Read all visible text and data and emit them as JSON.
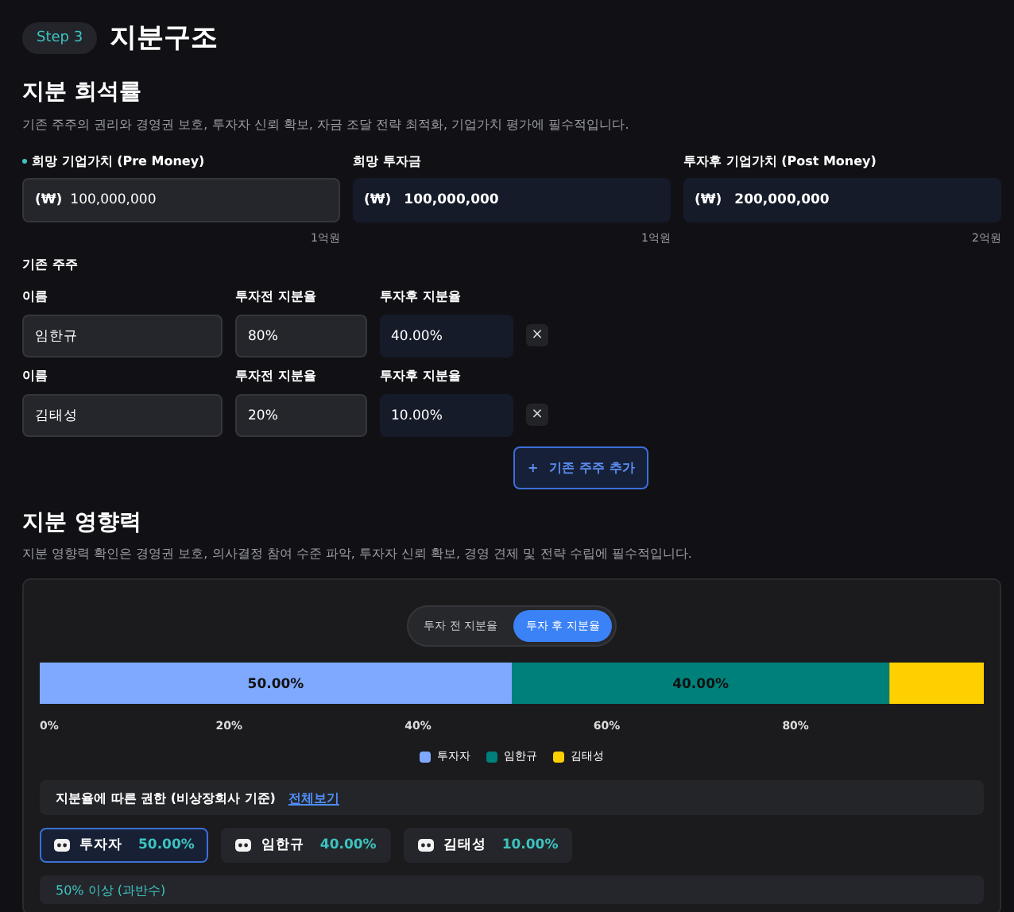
{
  "step": {
    "badge": "Step 3",
    "title": "지분구조"
  },
  "dilution": {
    "title": "지분 희석률",
    "description": "기존 주주의 권리와 경영권 보호, 투자자 신뢰 확보, 자금 조달 전략 최적화, 기업가치 평가에 필수적입니다.",
    "fields": [
      {
        "label": "희망 기업가치 (Pre Money)",
        "required": true,
        "kind": "input",
        "prefix": "(₩)",
        "value": "100,000,000",
        "hint": "1억원"
      },
      {
        "label": "희망 투자금",
        "required": false,
        "kind": "computed",
        "prefix": "(₩)",
        "value": "100,000,000",
        "hint": "1억원"
      },
      {
        "label": "투자후 기업가치 (Post Money)",
        "required": false,
        "kind": "computed",
        "prefix": "(₩)",
        "value": "200,000,000",
        "hint": "2억원"
      }
    ]
  },
  "shareholders": {
    "title": "기존 주주",
    "rows": [
      {
        "name_label": "이름",
        "name": "임한규",
        "pre_label": "투자전 지분율",
        "pre": "80%",
        "post_label": "투자후 지분율",
        "post": "40.00%",
        "remove": "×"
      },
      {
        "name_label": "이름",
        "name": "김태성",
        "pre_label": "투자전 지분율",
        "pre": "20%",
        "post_label": "투자후 지분율",
        "post": "10.00%",
        "remove": "×"
      }
    ],
    "add_button": {
      "icon": "+",
      "label": "기존 주주 추가"
    }
  },
  "influence": {
    "title": "지분 영향력",
    "description": "지분 영향력 확인은 경영권 보호, 의사결정 참여 수준 파악, 투자자 신뢰 확보, 경영 견제 및 전략 수립에 필수적입니다.",
    "toggle": [
      {
        "label": "투자 전 지분율",
        "selected": false
      },
      {
        "label": "투자 후 지분율",
        "selected": true
      }
    ],
    "chart_data": {
      "type": "bar",
      "orientation": "horizontal",
      "stacked": true,
      "series": [
        {
          "name": "투자자",
          "color": "#7fa9ff",
          "values": [
            50
          ]
        },
        {
          "name": "임한규",
          "color": "#00807a",
          "values": [
            40
          ]
        },
        {
          "name": "김태성",
          "color": "#ffd000",
          "values": [
            10
          ]
        }
      ],
      "xlim": [
        0,
        100
      ],
      "xticks": [
        {
          "value": 0,
          "label": "0%"
        },
        {
          "value": 20,
          "label": "20%"
        },
        {
          "value": 40,
          "label": "40%"
        },
        {
          "value": 60,
          "label": "60%"
        },
        {
          "value": 80,
          "label": "80%"
        }
      ],
      "value_labels": [
        "50.00%",
        "40.00%",
        null
      ]
    },
    "rights": {
      "title": "지분율에 따른 권한 (비상장회사 기준)",
      "link": "전체보기"
    },
    "holders": [
      {
        "name": "투자자",
        "share": "50.00%",
        "selected": true
      },
      {
        "name": "임한규",
        "share": "40.00%",
        "selected": false
      },
      {
        "name": "김태성",
        "share": "10.00%",
        "selected": false
      }
    ],
    "threshold": {
      "label": "50% 이상 (과반수)"
    }
  }
}
